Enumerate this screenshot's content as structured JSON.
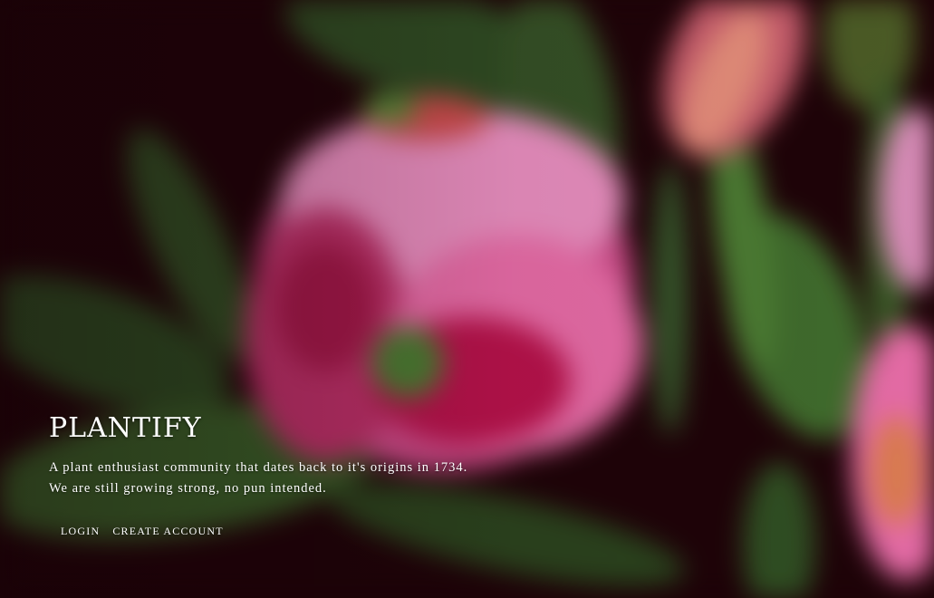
{
  "hero": {
    "brand": "PLANTIFY",
    "tagline_line1": "A plant enthusiast community that dates back to it's origins in 1734.",
    "tagline_line2": "We are still growing strong, no pun intended."
  },
  "actions": {
    "login_label": "LOGIN",
    "create_account_label": "CREATE ACCOUNT"
  },
  "colors": {
    "background": "#1e0308",
    "petal_pink": "#e36aa4",
    "petal_deep": "#b4124a",
    "leaf_green": "#3f6a2c",
    "text": "#ffffff"
  }
}
